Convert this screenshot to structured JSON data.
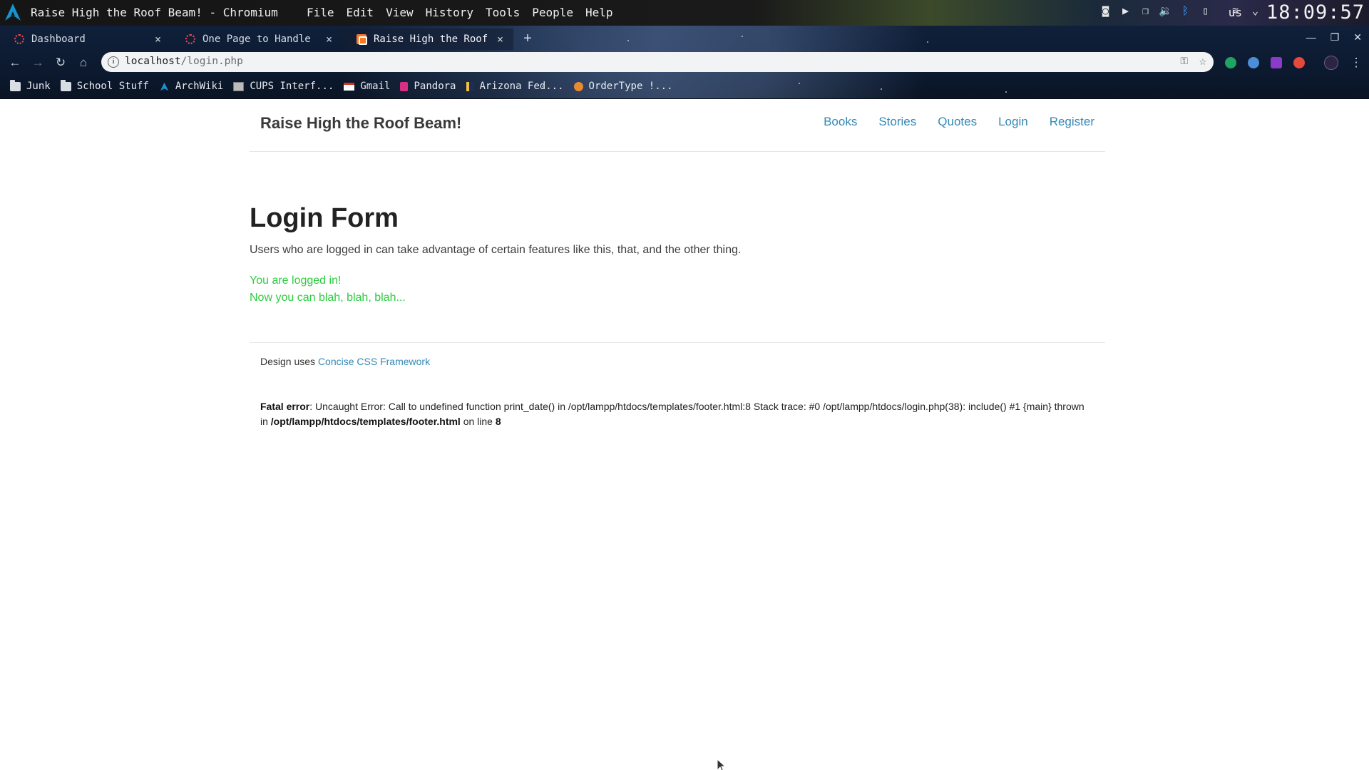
{
  "desktop": {
    "window_title": "Raise High the Roof Beam! - Chromium",
    "menus": [
      "File",
      "Edit",
      "View",
      "History",
      "Tools",
      "People",
      "Help"
    ],
    "keyboard_layout": "us",
    "clock": "18:09:57"
  },
  "browser": {
    "tabs": [
      {
        "label": "Dashboard",
        "close": "×"
      },
      {
        "label": "One Page to Handle",
        "close": "×"
      },
      {
        "label": "Raise High the Roof",
        "close": "×"
      }
    ],
    "new_tab": "+",
    "address": {
      "host": "localhost",
      "path": "/login.php"
    },
    "bookmarks": [
      "Junk",
      "School Stuff",
      "ArchWiki",
      "CUPS Interf...",
      "Gmail",
      "Pandora",
      "Arizona Fed...",
      "OrderType !..."
    ]
  },
  "site": {
    "brand": "Raise High the Roof Beam!",
    "nav": [
      "Books",
      "Stories",
      "Quotes",
      "Login",
      "Register"
    ]
  },
  "main": {
    "title": "Login Form",
    "description": "Users who are logged in can take advantage of certain features like this, that, and the other thing.",
    "success_line1": "You are logged in!",
    "success_line2": "Now you can blah, blah, blah..."
  },
  "footer": {
    "design_prefix": "Design uses ",
    "design_link": "Concise CSS Framework",
    "error_label": "Fatal error",
    "error_message": ": Uncaught Error: Call to undefined function print_date() in /opt/lampp/htdocs/templates/footer.html:8 Stack trace: #0 /opt/lampp/htdocs/login.php(38): include() #1 {main} thrown in ",
    "error_file": "/opt/lampp/htdocs/templates/footer.html",
    "error_on_line": " on line ",
    "error_line": "8"
  },
  "colors": {
    "link": "#3488b5",
    "success": "#2ecc40",
    "heading": "#222222"
  }
}
